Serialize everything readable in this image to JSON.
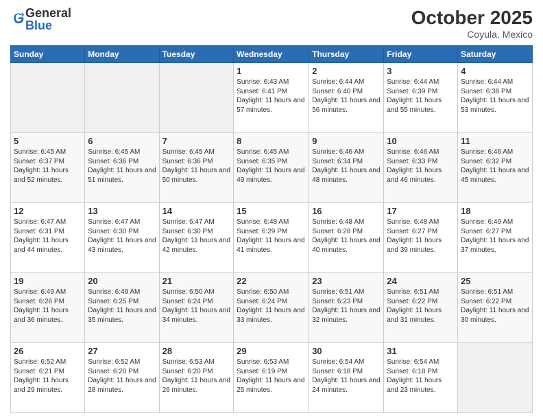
{
  "logo": {
    "general": "General",
    "blue": "Blue"
  },
  "title": "October 2025",
  "location": "Coyula, Mexico",
  "days_of_week": [
    "Sunday",
    "Monday",
    "Tuesday",
    "Wednesday",
    "Thursday",
    "Friday",
    "Saturday"
  ],
  "weeks": [
    [
      {
        "day": "",
        "info": ""
      },
      {
        "day": "",
        "info": ""
      },
      {
        "day": "",
        "info": ""
      },
      {
        "day": "1",
        "info": "Sunrise: 6:43 AM\nSunset: 6:41 PM\nDaylight: 11 hours and 57 minutes."
      },
      {
        "day": "2",
        "info": "Sunrise: 6:44 AM\nSunset: 6:40 PM\nDaylight: 11 hours and 56 minutes."
      },
      {
        "day": "3",
        "info": "Sunrise: 6:44 AM\nSunset: 6:39 PM\nDaylight: 11 hours and 55 minutes."
      },
      {
        "day": "4",
        "info": "Sunrise: 6:44 AM\nSunset: 6:38 PM\nDaylight: 11 hours and 53 minutes."
      }
    ],
    [
      {
        "day": "5",
        "info": "Sunrise: 6:45 AM\nSunset: 6:37 PM\nDaylight: 11 hours and 52 minutes."
      },
      {
        "day": "6",
        "info": "Sunrise: 6:45 AM\nSunset: 6:36 PM\nDaylight: 11 hours and 51 minutes."
      },
      {
        "day": "7",
        "info": "Sunrise: 6:45 AM\nSunset: 6:36 PM\nDaylight: 11 hours and 50 minutes."
      },
      {
        "day": "8",
        "info": "Sunrise: 6:45 AM\nSunset: 6:35 PM\nDaylight: 11 hours and 49 minutes."
      },
      {
        "day": "9",
        "info": "Sunrise: 6:46 AM\nSunset: 6:34 PM\nDaylight: 11 hours and 48 minutes."
      },
      {
        "day": "10",
        "info": "Sunrise: 6:46 AM\nSunset: 6:33 PM\nDaylight: 11 hours and 46 minutes."
      },
      {
        "day": "11",
        "info": "Sunrise: 6:46 AM\nSunset: 6:32 PM\nDaylight: 11 hours and 45 minutes."
      }
    ],
    [
      {
        "day": "12",
        "info": "Sunrise: 6:47 AM\nSunset: 6:31 PM\nDaylight: 11 hours and 44 minutes."
      },
      {
        "day": "13",
        "info": "Sunrise: 6:47 AM\nSunset: 6:30 PM\nDaylight: 11 hours and 43 minutes."
      },
      {
        "day": "14",
        "info": "Sunrise: 6:47 AM\nSunset: 6:30 PM\nDaylight: 11 hours and 42 minutes."
      },
      {
        "day": "15",
        "info": "Sunrise: 6:48 AM\nSunset: 6:29 PM\nDaylight: 11 hours and 41 minutes."
      },
      {
        "day": "16",
        "info": "Sunrise: 6:48 AM\nSunset: 6:28 PM\nDaylight: 11 hours and 40 minutes."
      },
      {
        "day": "17",
        "info": "Sunrise: 6:48 AM\nSunset: 6:27 PM\nDaylight: 11 hours and 39 minutes."
      },
      {
        "day": "18",
        "info": "Sunrise: 6:49 AM\nSunset: 6:27 PM\nDaylight: 11 hours and 37 minutes."
      }
    ],
    [
      {
        "day": "19",
        "info": "Sunrise: 6:49 AM\nSunset: 6:26 PM\nDaylight: 11 hours and 36 minutes."
      },
      {
        "day": "20",
        "info": "Sunrise: 6:49 AM\nSunset: 6:25 PM\nDaylight: 11 hours and 35 minutes."
      },
      {
        "day": "21",
        "info": "Sunrise: 6:50 AM\nSunset: 6:24 PM\nDaylight: 11 hours and 34 minutes."
      },
      {
        "day": "22",
        "info": "Sunrise: 6:50 AM\nSunset: 6:24 PM\nDaylight: 11 hours and 33 minutes."
      },
      {
        "day": "23",
        "info": "Sunrise: 6:51 AM\nSunset: 6:23 PM\nDaylight: 11 hours and 32 minutes."
      },
      {
        "day": "24",
        "info": "Sunrise: 6:51 AM\nSunset: 6:22 PM\nDaylight: 11 hours and 31 minutes."
      },
      {
        "day": "25",
        "info": "Sunrise: 6:51 AM\nSunset: 6:22 PM\nDaylight: 11 hours and 30 minutes."
      }
    ],
    [
      {
        "day": "26",
        "info": "Sunrise: 6:52 AM\nSunset: 6:21 PM\nDaylight: 11 hours and 29 minutes."
      },
      {
        "day": "27",
        "info": "Sunrise: 6:52 AM\nSunset: 6:20 PM\nDaylight: 11 hours and 28 minutes."
      },
      {
        "day": "28",
        "info": "Sunrise: 6:53 AM\nSunset: 6:20 PM\nDaylight: 11 hours and 26 minutes."
      },
      {
        "day": "29",
        "info": "Sunrise: 6:53 AM\nSunset: 6:19 PM\nDaylight: 11 hours and 25 minutes."
      },
      {
        "day": "30",
        "info": "Sunrise: 6:54 AM\nSunset: 6:18 PM\nDaylight: 11 hours and 24 minutes."
      },
      {
        "day": "31",
        "info": "Sunrise: 6:54 AM\nSunset: 6:18 PM\nDaylight: 11 hours and 23 minutes."
      },
      {
        "day": "",
        "info": ""
      }
    ]
  ]
}
